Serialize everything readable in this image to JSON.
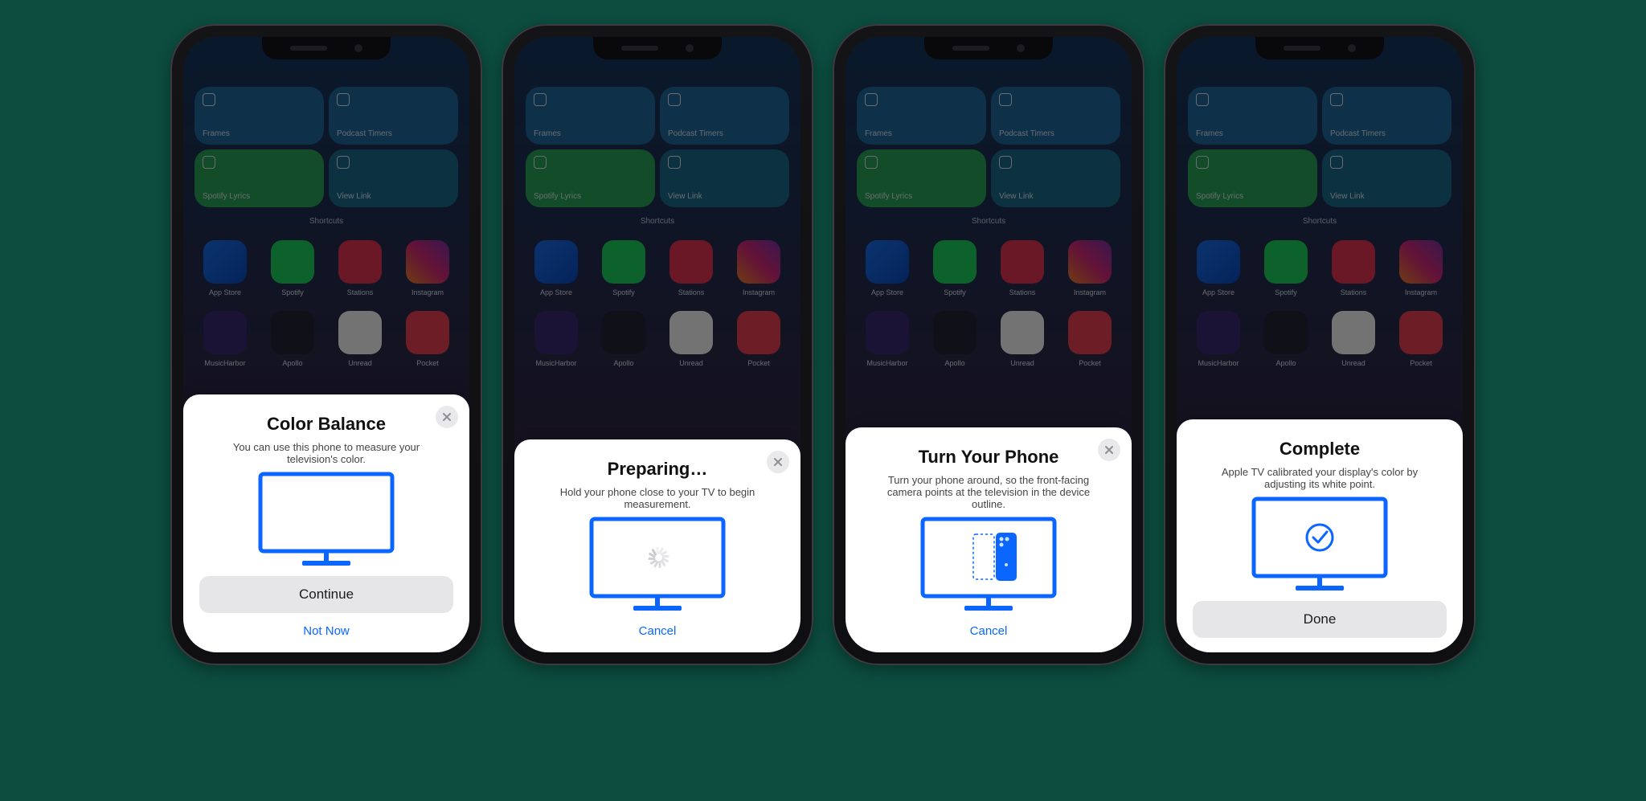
{
  "colors": {
    "accent": "#0b66ff"
  },
  "widget": {
    "label": "Shortcuts",
    "tiles": [
      {
        "name": "Frames"
      },
      {
        "name": "Podcast Timers"
      },
      {
        "name": "Spotify Lyrics"
      },
      {
        "name": "View Link"
      }
    ]
  },
  "apps": [
    {
      "name": "App Store",
      "class": "c-appstore"
    },
    {
      "name": "Spotify",
      "class": "c-spot"
    },
    {
      "name": "Stations",
      "class": "c-stat"
    },
    {
      "name": "Instagram",
      "class": "c-ig"
    },
    {
      "name": "MusicHarbor",
      "class": "c-mh"
    },
    {
      "name": "Apollo",
      "class": "c-apollo"
    },
    {
      "name": "Unread",
      "class": "c-unread"
    },
    {
      "name": "Pocket",
      "class": "c-pocket"
    }
  ],
  "screens": [
    {
      "id": "color-balance",
      "title": "Color Balance",
      "desc": "You can use this phone to measure your television's color.",
      "hasClose": true,
      "illustration": "tv-blank",
      "primary": "Continue",
      "link": "Not Now"
    },
    {
      "id": "preparing",
      "title": "Preparing…",
      "desc": "Hold your phone close to your TV to begin measurement.",
      "hasClose": true,
      "illustration": "tv-spinner",
      "link": "Cancel"
    },
    {
      "id": "turn-phone",
      "title": "Turn Your Phone",
      "desc": "Turn your phone around, so the front-facing camera points at the television in the device outline.",
      "hasClose": true,
      "illustration": "tv-phone",
      "link": "Cancel"
    },
    {
      "id": "complete",
      "title": "Complete",
      "desc": "Apple TV calibrated your display's color by adjusting its white point.",
      "hasClose": false,
      "illustration": "tv-check",
      "primary": "Done"
    }
  ]
}
